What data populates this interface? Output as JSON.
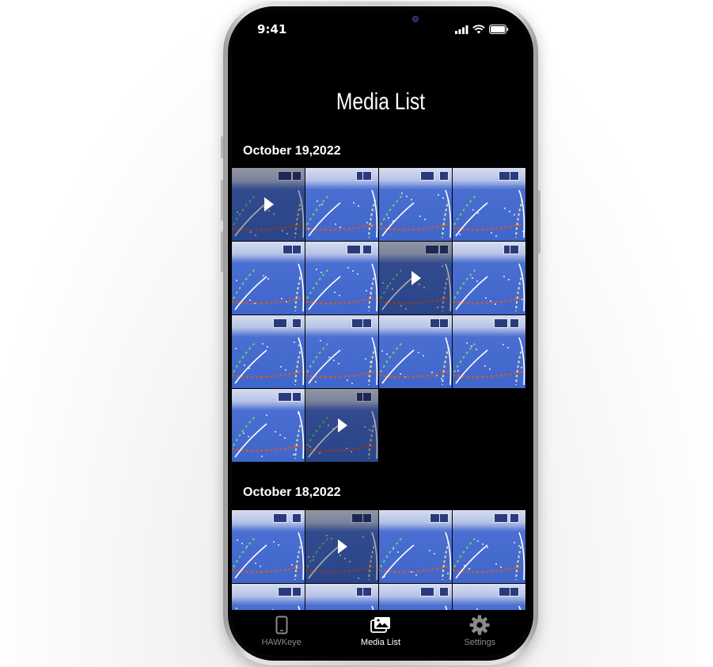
{
  "status_bar": {
    "time": "9:41",
    "icons": [
      "signal-icon",
      "wifi-icon",
      "battery-icon"
    ]
  },
  "page": {
    "title": "Media List"
  },
  "sections": [
    {
      "date": "October 19,2022",
      "items": [
        {
          "type": "video"
        },
        {
          "type": "photo"
        },
        {
          "type": "photo"
        },
        {
          "type": "photo"
        },
        {
          "type": "photo"
        },
        {
          "type": "photo"
        },
        {
          "type": "video"
        },
        {
          "type": "photo"
        },
        {
          "type": "photo"
        },
        {
          "type": "photo"
        },
        {
          "type": "photo"
        },
        {
          "type": "photo"
        },
        {
          "type": "photo"
        },
        {
          "type": "video"
        }
      ]
    },
    {
      "date": "October 18,2022",
      "items": [
        {
          "type": "photo"
        },
        {
          "type": "video"
        },
        {
          "type": "photo"
        },
        {
          "type": "photo"
        },
        {
          "type": "photo"
        },
        {
          "type": "photo"
        },
        {
          "type": "photo"
        },
        {
          "type": "photo"
        }
      ]
    }
  ],
  "tab_bar": {
    "tabs": [
      {
        "label": "HAWKeye",
        "icon": "phone-icon",
        "active": false
      },
      {
        "label": "Media List",
        "icon": "gallery-icon",
        "active": true
      },
      {
        "label": "Settings",
        "icon": "gear-icon",
        "active": false
      }
    ]
  },
  "colors": {
    "active_tab": "#ffffff",
    "inactive_tab": "#8a8a8a",
    "background": "#000000"
  }
}
